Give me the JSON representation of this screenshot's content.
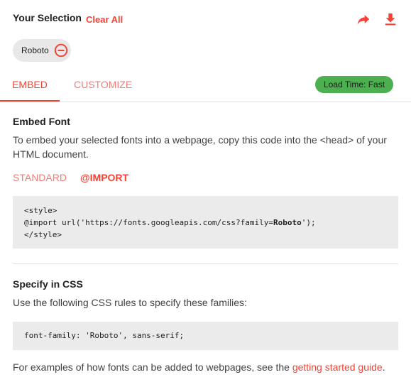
{
  "header": {
    "title": "Your Selection",
    "clear_all": "Clear All"
  },
  "selection": {
    "chip_label": "Roboto"
  },
  "tabs": {
    "embed": "EMBED",
    "customize": "CUSTOMIZE",
    "load_time": "Load Time: Fast"
  },
  "embed": {
    "title": "Embed Font",
    "description": "To embed your selected fonts into a webpage, copy this code into the <head> of your HTML document.",
    "subtabs": {
      "standard": "STANDARD",
      "import": "@IMPORT"
    },
    "code": {
      "line1": "<style>",
      "line2_prefix": "@import url('https://fonts.googleapis.com/css?family=",
      "line2_family": "Roboto",
      "line2_suffix": "');",
      "line3": "</style>"
    }
  },
  "css": {
    "title": "Specify in CSS",
    "description": "Use the following CSS rules to specify these families:",
    "code": "font-family: 'Roboto', sans-serif;"
  },
  "footer": {
    "text": "For examples of how fonts can be added to webpages, see the ",
    "link": "getting started guide",
    "period": "."
  },
  "colors": {
    "accent": "#f44336",
    "accent_light": "#ef7e7a",
    "badge_green": "#4caf50",
    "code_bg": "#ebebeb"
  },
  "icons": {
    "share": "share-icon",
    "download": "download-icon",
    "remove": "remove-circle-icon"
  }
}
